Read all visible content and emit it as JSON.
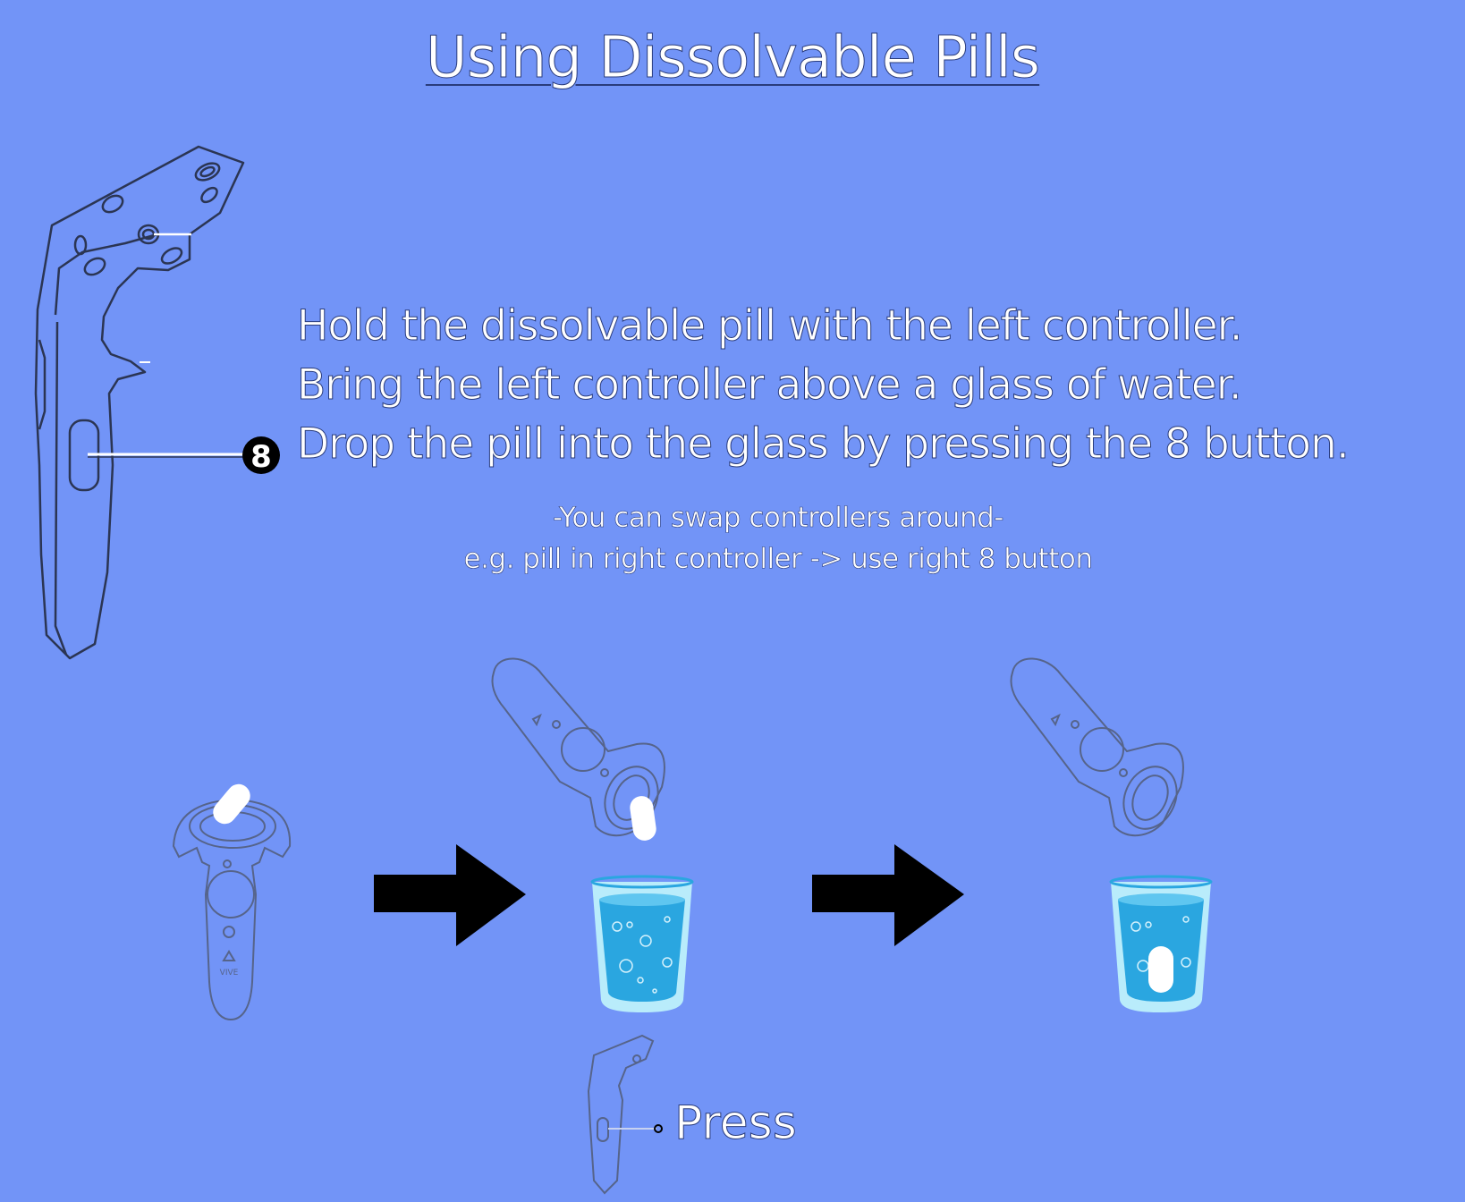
{
  "title": "Using Dissolvable Pills",
  "instructions": [
    "Hold the dissolvable pill with the left controller.",
    "Bring the left controller above a glass of water.",
    "Drop the pill into the glass by pressing the 8 button."
  ],
  "notes": [
    "-You can swap controllers around-",
    "e.g. pill in right controller -> use right 8 button"
  ],
  "button_number": "8",
  "press_label": "Press",
  "controller_brand": "VIVE",
  "colors": {
    "background": "#7294f7",
    "water": "#2aa6e0",
    "glass_rim": "#b9ecfb",
    "arrow": "#000000",
    "pill": "#ffffff"
  }
}
